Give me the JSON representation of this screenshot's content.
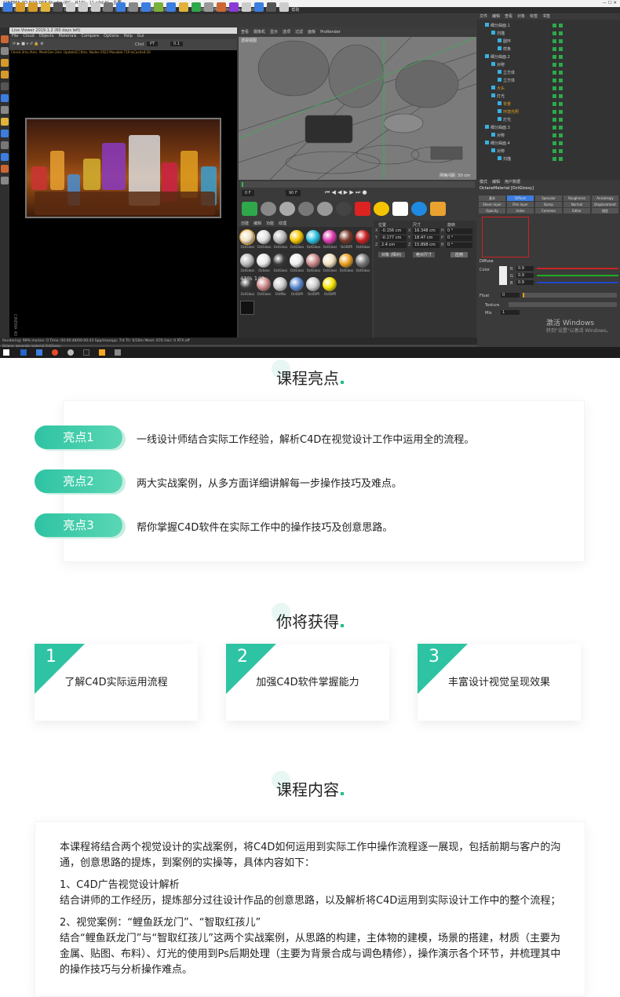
{
  "screenshot": {
    "title": "CINEMA 4D R19.068 Studio (RC - R19) - [1.c4d *] - 主要",
    "menu": [
      "文件",
      "编辑",
      "创建",
      "选择",
      "工具",
      "网格",
      "捕捉",
      "动画",
      "模拟",
      "渲染",
      "雕刻",
      "运动跟踪",
      "运动图形",
      "角色",
      "流水线",
      "插件",
      "X-Particles",
      "Octane",
      "脚本",
      "窗口",
      "帮助"
    ],
    "live_viewer_title": "Live Viewer 2019.1.2 (60 days left)",
    "live_viewer_menu": [
      "File",
      "Cloud",
      "Objects",
      "Materials",
      "Compare",
      "Options",
      "Help",
      "Gui"
    ],
    "live_viewer_status": "Check:3ms./Ams. MeshGen:3ms. Update[C]:0ms. Nodes:1923 Movable:719 txCached:16",
    "chan_label": "Chnl",
    "chan_value": "PT",
    "chan_num": "0.1",
    "viewport_menu": [
      "查看",
      "摄像机",
      "显示",
      "选项",
      "过滤",
      "面板",
      "ProRender"
    ],
    "viewport_label": "透视视图",
    "grid_label": "网格间距: 50 cm",
    "timeline_frame_start": "0 F",
    "timeline_frame_end": "90 F",
    "material_menu": [
      "创建",
      "编辑",
      "功能",
      "纹理"
    ],
    "material_labels": [
      "OctGloss",
      "OctGloss",
      "OctGloss",
      "OctGloss",
      "OctGloss",
      "OctGloss",
      "OctDiffi",
      "OctGloss",
      "OctGloss",
      "Octane",
      "OctGloss",
      "OctGloss",
      "OctGloss",
      "OctGloss",
      "OctGloss",
      "OctGloss",
      "OctGloss",
      "OctGloss",
      "OctMix",
      "OctDiffi",
      "OctDiffi",
      "OctDiffi"
    ],
    "material_overlay": "41%  145",
    "coords_headers": [
      "位置",
      "尺寸",
      "旋转"
    ],
    "coords_rows": [
      [
        "X",
        "-0.156 cm",
        "X",
        "16.348 cm",
        "H",
        "0 °"
      ],
      [
        "Y",
        "-0.177 cm",
        "Y",
        "18.47 cm",
        "P",
        "0 °"
      ],
      [
        "Z",
        "2.4 cm",
        "Z",
        "15.898 cm",
        "B",
        "0 °"
      ]
    ],
    "coords_dropdown1": "对象 (相对)",
    "coords_dropdown2": "绝对尺寸",
    "coords_apply": "应用",
    "object_menu": [
      "文件",
      "编辑",
      "查看",
      "对象",
      "标签",
      "书签"
    ],
    "object_rows": [
      "细分曲面.1",
      "扫描",
      "圆环",
      "样条",
      "细分曲面.2",
      "对称",
      "立方体",
      "立方体",
      "大头",
      "灯光",
      "背景",
      "环境光照",
      "灯光",
      "细分曲面.3",
      "对称",
      "细分曲面.4",
      "对称",
      "扫描"
    ],
    "attr_menu": [
      "模式",
      "编辑",
      "用户数据"
    ],
    "attr_material": "OctaneMaterial [OctGlossy]",
    "attr_tabs": [
      "基本",
      "Diffuse",
      "Specular",
      "Roughness",
      "Anisotropy",
      "Sheen layer",
      "Film layer",
      "Bump",
      "Normal",
      "Displacement",
      "Opacity",
      "Index",
      "Common",
      "Editor",
      "指定"
    ],
    "attr_section": "Diffuse",
    "attr_color_label": "Color",
    "attr_rgb": [
      {
        "ch": "R",
        "v": "0.9"
      },
      {
        "ch": "G",
        "v": "0.9"
      },
      {
        "ch": "B",
        "v": "0.9"
      }
    ],
    "attr_float_label": "Float",
    "attr_float_value": "0",
    "attr_texture_label": "Texture",
    "attr_mix_label": "Mix",
    "attr_mix_value": "1",
    "activate_line1": "激活 Windows",
    "activate_line2": "转到\"设置\"以激活 Windows。",
    "statusbar": "Octane: generate material OctGlossy",
    "render_status": "Rendering: 99%   ms/sec: 0   Time: 00:00:48/00:00:43   Spp/maxspp: 7/4   Tri: 0/16m   Mesh: 676   Hair: 0   RTX:off"
  },
  "highlights": {
    "title": "课程亮点",
    "items": [
      {
        "label": "亮点1",
        "text": "一线设计师结合实际工作经验，解析C4D在视觉设计工作中运用全的流程。"
      },
      {
        "label": "亮点2",
        "text": "两大实战案例，从多方面详细讲解每一步操作技巧及难点。"
      },
      {
        "label": "亮点3",
        "text": "帮你掌握C4D软件在实际工作中的操作技巧及创意思路。"
      }
    ]
  },
  "gains": {
    "title": "你将获得",
    "items": [
      {
        "num": "1",
        "text": "了解C4D实际运用流程"
      },
      {
        "num": "2",
        "text": "加强C4D软件掌握能力"
      },
      {
        "num": "3",
        "text": "丰富设计视觉呈现效果"
      }
    ]
  },
  "content": {
    "title": "课程内容",
    "intro": "本课程将结合两个视觉设计的实战案例，将C4D如何运用到实际工作中操作流程逐一展现，包括前期与客户的沟通，创意思路的提炼，到案例的实操等，具体内容如下：",
    "sec1_title": "1、C4D广告视觉设计解析",
    "sec1_text": "结合讲师的工作经历，提炼部分过往设计作品的创意思路，以及解析将C4D运用到实际设计工作中的整个流程；",
    "sec2_title": "2、视觉案例：“鲤鱼跃龙门”、“智取红孩儿”",
    "sec2_text": "结合“鲤鱼跃龙门”与“智取红孩儿”这两个实战案例，从思路的构建，主体物的建模，场景的搭建，材质（主要为金属、贴图、布料）、灯光的使用到Ps后期处理（主要为背景合成与调色精修），操作演示各个环节，并梳理其中的操作技巧与分析操作难点。"
  },
  "colors": {
    "accent": "#2ec3a3",
    "accent_light": "#5ad7b4",
    "dot": "#1ec08f"
  }
}
